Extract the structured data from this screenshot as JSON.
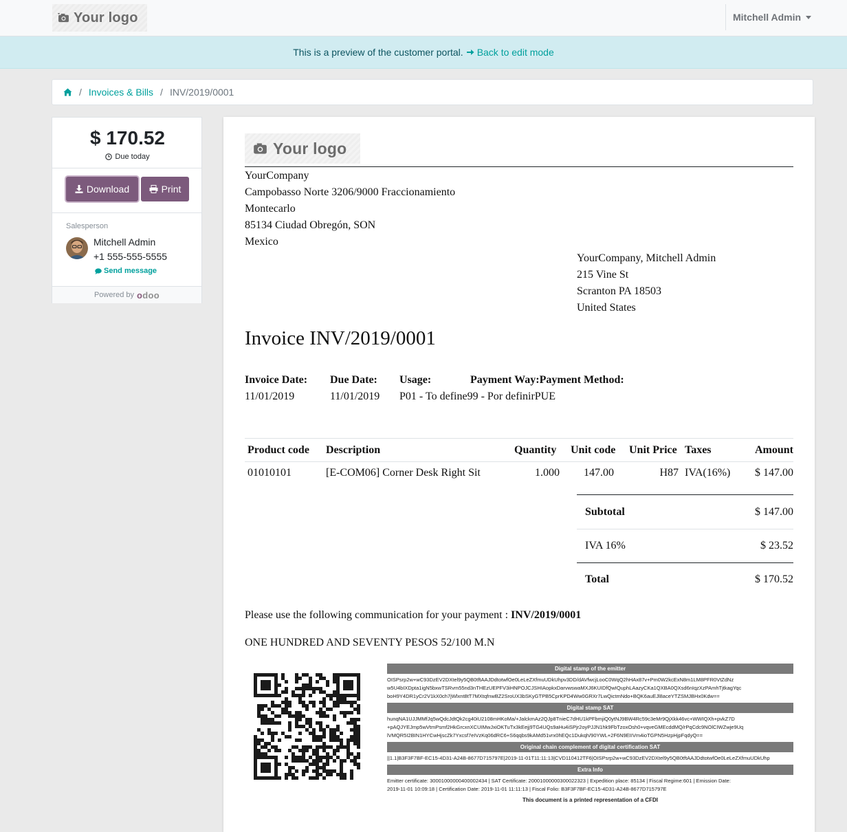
{
  "topbar": {
    "logo_text": "Your logo",
    "user_name": "Mitchell Admin"
  },
  "preview": {
    "text": "This is a preview of the customer portal.",
    "link": "Back to edit mode"
  },
  "breadcrumb": {
    "section": "Invoices & Bills",
    "current": "INV/2019/0001"
  },
  "sidebar": {
    "amount": "$ 170.52",
    "due": "Due today",
    "download_label": "Download",
    "print_label": "Print",
    "salesperson_label": "Salesperson",
    "salesperson_name": "Mitchell Admin",
    "salesperson_phone": "+1 555-555-5555",
    "send_message": "Send message",
    "powered_by": "Powered by",
    "odoo": "odoo"
  },
  "invoice": {
    "logo_text": "Your logo",
    "company_address": [
      "YourCompany",
      "Campobasso Norte 3206/9000 Fraccionamiento",
      "Montecarlo",
      "85134 Ciudad Obregón, SON",
      "Mexico"
    ],
    "customer_address": [
      "YourCompany, Mitchell Admin",
      "215 Vine St",
      "Scranton PA 18503",
      "United States"
    ],
    "title": "Invoice INV/2019/0001",
    "info": {
      "invoice_date_label": "Invoice Date:",
      "invoice_date": "11/01/2019",
      "due_date_label": "Due Date:",
      "due_date": "11/01/2019",
      "usage_label": "Usage:",
      "usage": "P01 - To define",
      "payment_way_label": "Payment Way:",
      "payment_way": "99 - Por definir",
      "payment_method_label": "Payment Method:",
      "payment_method": "PUE"
    },
    "columns": [
      "Product code",
      "Description",
      "Quantity",
      "Unit code",
      "Unit Price",
      "Taxes",
      "Amount"
    ],
    "line": {
      "product_code": "01010101",
      "description": "[E-COM06] Corner Desk Right Sit",
      "quantity": "1.000",
      "unit_code": "147.00",
      "unit_price": "H87",
      "taxes": "IVA(16%)",
      "amount": "$ 147.00"
    },
    "totals": {
      "subtotal_label": "Subtotal",
      "subtotal": "$ 147.00",
      "tax_label": "IVA 16%",
      "tax": "$ 23.52",
      "total_label": "Total",
      "total": "$ 170.52"
    },
    "communication_text": "Please use the following communication for your payment :",
    "communication_ref": "INV/2019/0001",
    "amount_words": "ONE HUNDRED AND SEVENTY PESOS 52/100 M.N",
    "cfdi": {
      "emitter_stamp_title": "Digital stamp of the emitter",
      "emitter_stamp": "OISPsrp2w+wC93DzEV2DXtel9y5QB0tftAAJDdtotwfOe0LeLeZXfmuUDkUhpv3DD/dAVfwcjLooC0WqQ2hHAx87v+Pm0W2kcExN8m1LM8PFR0VtZdNz\nw5U4bIXDpta1igN5bxwTSRvm55nd3nTHEzUEPFV3iHNPOJCJSHIAopkxDarvwswaMXJ6KUIDfQwIQuphLAazyCKa1QXBA0QXsd6nIqzXzPAmhTjtkagYqc\nboH9Y4DR1yCr2V1kX0ch7jWlxnt8tT7MXtqfnwBZ2SroUX3bSKyGTPB5CprKPD4Ww0GRXr7LwQictmNdo+BQK6auEJl8aceYTZSMJBHx0Kdw==",
      "sat_stamp_title": "Digital stamp SAT",
      "sat_stamp": "hunqNA1UJJMMfJq5wQdcJdtQk2cg40iU2108mHKoMa/+JalckmAz2QJp8TnieC7dHU1kPFbmjiQ0ytNJ9BW4Rc59c3eMr9QjXkk46vc+WWIQXh+pvkZ7D\n+pAQJYEJmp5wVtmPsmf2HkGrcxnXCUIMwJxiOKTuTx3kEejj9TG4UQs9aHu4iSPjr2oyPJJN1hk9FbTzoxOsh0+vqveGMEcddMQ/rPqCdc9NOlCIWZwje9Uq\nlVMQR5I2BIN1HYCwHjscZk7Yxcsf7eIVzKq06dRC6+S6qqbs9kAMd51vrx0hEQc1Dukqh/90YWL+2F6N9EIIVm4ioTGPN5HzpHjpFqdyQ==",
      "chain_title": "Original chain complement of digital certification SAT",
      "chain": "||1.1|B3F3F7BF-EC15-4D31-A24B-8677D715797E|2019-11-01T11:11:13|CVD110412TF6|OISPsrp2w+wC93DzEV2DXtel9y5QB0tftAAJDdtotwfOe0LeLeZXfmuUDkUhp",
      "extra_title": "Extra Info",
      "extra": "Emitter certificate: 30001000000400002434 | SAT Certificate: 20001000000300022323 | Expedition place: 85134 | Fiscal Regime:601 | Emission Date:\n2019-11-01 10:09:18 | Certification Date: 2019-11-01 11:11:13 | Fiscal Folio: B3F3F7BF-EC15-4D31-A24B-8677D715797E",
      "footer": "This document is a printed representation of a CFDI"
    }
  },
  "colors": {
    "accent": "#00a09d",
    "button": "#7c5a7c",
    "preview_bg": "#d1ecf1"
  }
}
